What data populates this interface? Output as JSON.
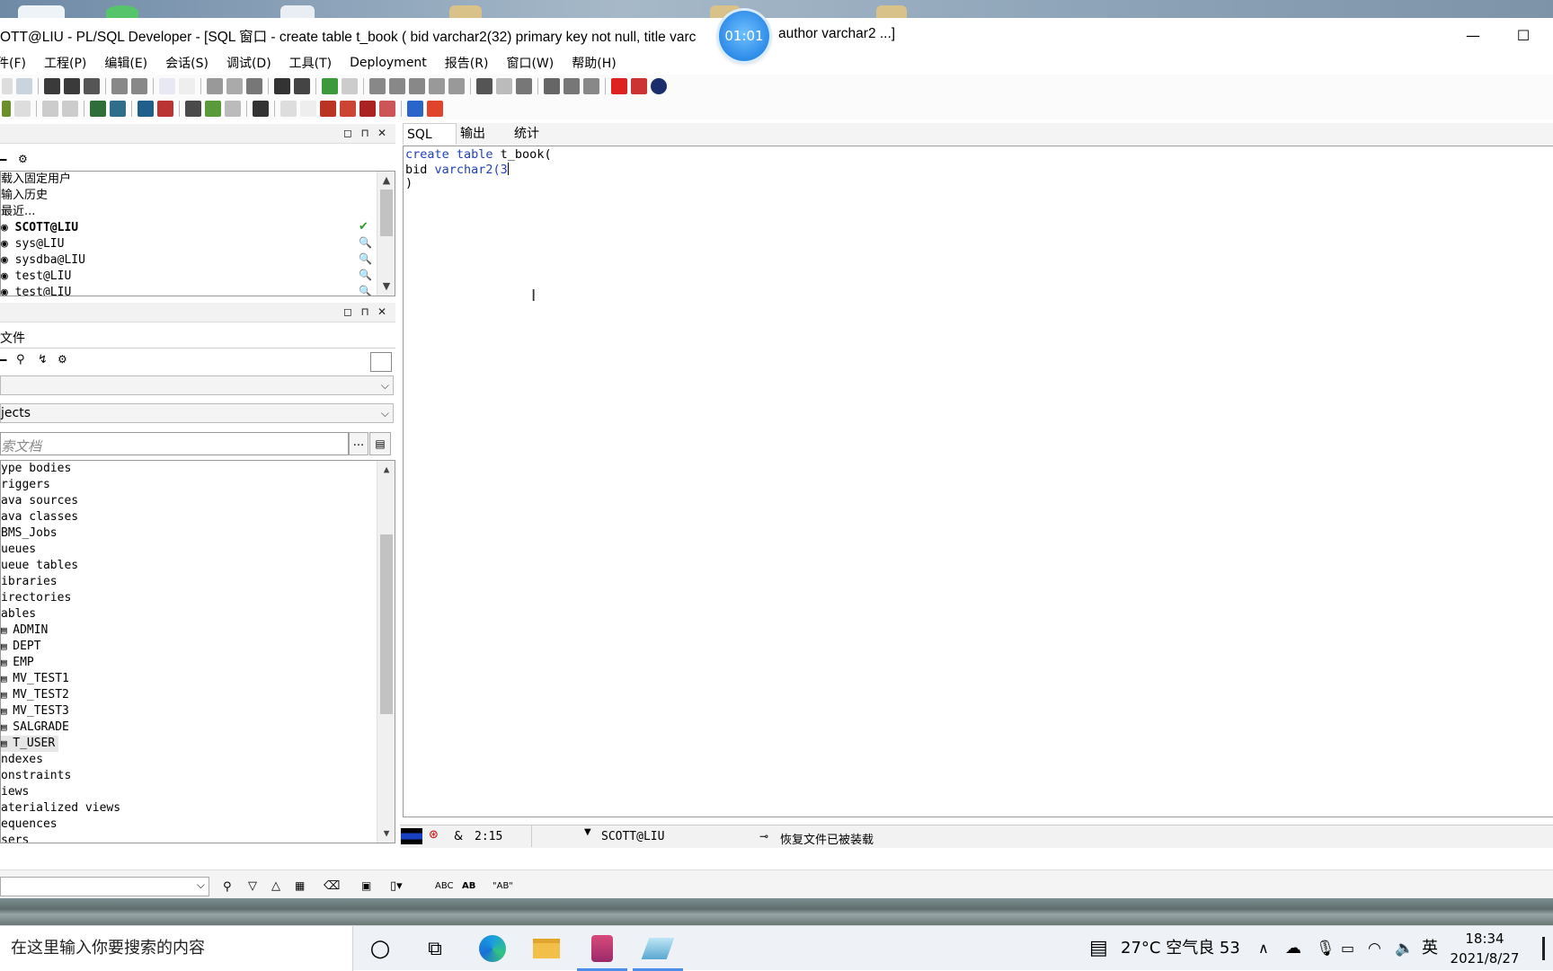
{
  "window": {
    "title_left": "OTT@LIU - PL/SQL Developer - [SQL 窗口 - create table t_book ( bid varchar2(32) primary key not null, title varc",
    "title_right": "author varchar2 ...]",
    "recording_timer": "01:01",
    "minimize_symbol": "—",
    "maximize_symbol": "☐"
  },
  "menu": [
    "件(F)",
    "工程(P)",
    "编辑(E)",
    "会话(S)",
    "调试(D)",
    "工具(T)",
    "Deployment",
    "报告(R)",
    "窗口(W)",
    "帮助(H)"
  ],
  "connections": {
    "rows": [
      "载入固定用户",
      "输入历史",
      "最近...",
      "SCOTT@LIU",
      "sys@LIU",
      "sysdba@LIU",
      "test@LIU",
      "test@LIU"
    ],
    "active": "SCOTT@LIU"
  },
  "browser": {
    "tab_label": "文件",
    "filter_value": "",
    "objects_combo": "jects",
    "search_placeholder": "索文档",
    "ellipsis": "...",
    "tree": [
      "ype bodies",
      "riggers",
      "ava sources",
      "ava classes",
      "BMS_Jobs",
      "ueues",
      "ueue tables",
      "ibraries",
      "irectories",
      "ables",
      "ADMIN",
      "DEPT",
      "EMP",
      "MV_TEST1",
      "MV_TEST2",
      "MV_TEST3",
      "SALGRADE",
      "T_USER",
      "ndexes",
      "onstraints",
      "iews",
      "aterialized views",
      "equences",
      "sers"
    ],
    "selected": "T_USER"
  },
  "editor": {
    "tabs": [
      "SQL",
      "输出",
      "统计"
    ],
    "active_tab": "SQL",
    "line1_kw": "create table",
    "line1_rest": " t_book(",
    "line2_a": "bid ",
    "line2_kw": "varchar2(3",
    "line3": ")"
  },
  "status": {
    "amp": "&",
    "cursor_pos": "2:15",
    "connection": "SCOTT@LIU",
    "message": "恢复文件已被装载"
  },
  "findbar": {
    "abc": "ABC",
    "ab": "AB",
    "quote_ab": "\"AB\""
  },
  "taskbar": {
    "search_placeholder": "在这里输入你要搜索的内容",
    "weather": "27°C 空气良 53",
    "ime": "英",
    "time": "18:34",
    "date": "2021/8/27"
  },
  "colors": {
    "accent": "#2d8be8",
    "keyword": "#1f3fbf",
    "selection": "#e6e6e6"
  }
}
